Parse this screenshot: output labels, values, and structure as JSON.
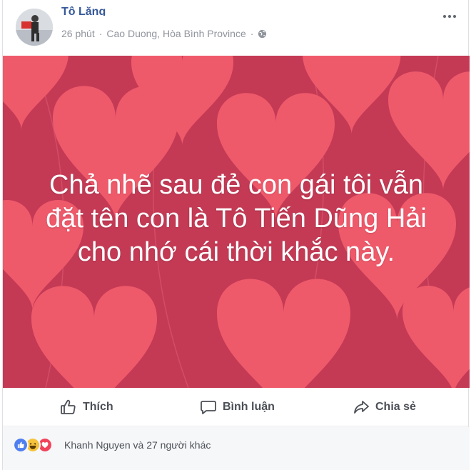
{
  "post": {
    "author": "Tô Lăng",
    "time": "26 phút",
    "location": "Cao Duong, Hòa Bình Province",
    "caption": "Chả nhẽ sau đẻ con gái tôi vẫn đặt tên con là Tô Tiến Dũng Hải cho nhớ cái thời khắc này.",
    "background_color": "#c43a55",
    "heart_color": "#ef5a6b"
  },
  "actions": {
    "like_label": "Thích",
    "comment_label": "Bình luận",
    "share_label": "Chia sẻ"
  },
  "reactions": {
    "icons": [
      "like-reaction-icon",
      "haha-reaction-icon",
      "love-reaction-icon"
    ],
    "summary": "Khanh Nguyen và 27 người khác"
  }
}
